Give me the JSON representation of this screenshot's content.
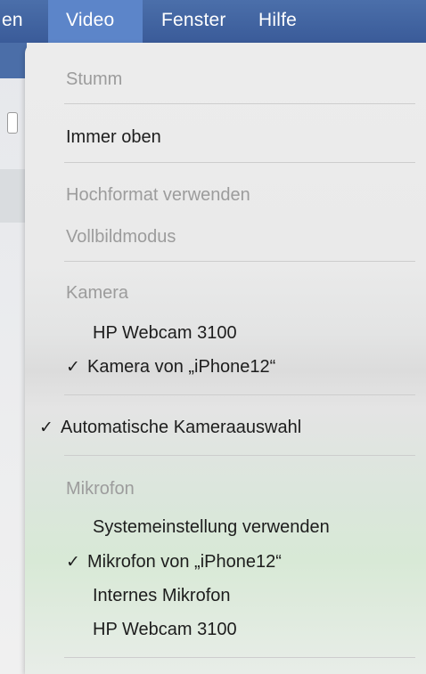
{
  "menubar": {
    "prev_menu": "en",
    "video": "Video",
    "fenster": "Fenster",
    "hilfe": "Hilfe"
  },
  "menu": {
    "stumm": "Stumm",
    "immer_oben": "Immer oben",
    "hochformat": "Hochformat verwenden",
    "vollbild": "Vollbildmodus",
    "kamera_header": "Kamera",
    "kamera_items": [
      {
        "label": "HP Webcam 3100",
        "checked": false
      },
      {
        "label": "Kamera von „iPhone12“",
        "checked": true
      }
    ],
    "auto_kamera": {
      "label": "Automatische Kameraauswahl",
      "checked": true
    },
    "mikrofon_header": "Mikrofon",
    "mikrofon_items": [
      {
        "label": "Systemeinstellung verwenden",
        "checked": false
      },
      {
        "label": "Mikrofon von „iPhone12“",
        "checked": true
      },
      {
        "label": "Internes Mikrofon",
        "checked": false
      },
      {
        "label": "HP Webcam 3100",
        "checked": false
      }
    ],
    "checkmark": "✓"
  }
}
